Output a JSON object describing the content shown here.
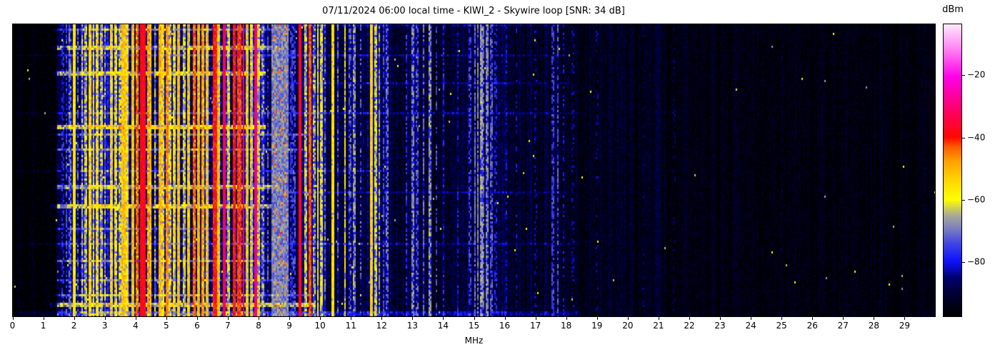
{
  "title": "07/11/2024 06:00 local time - KIWI_2 - Skywire loop [SNR: 34 dB]",
  "chart_data": {
    "type": "heatmap",
    "title": "07/11/2024 06:00 local time - KIWI_2 - Skywire loop [SNR: 34 dB]",
    "xlabel": "MHz",
    "x_range": [
      0,
      30
    ],
    "x_ticks": [
      "0",
      "1",
      "2",
      "3",
      "4",
      "5",
      "6",
      "7",
      "8",
      "9",
      "10",
      "11",
      "12",
      "13",
      "14",
      "15",
      "16",
      "17",
      "18",
      "19",
      "20",
      "21",
      "22",
      "23",
      "24",
      "25",
      "26",
      "27",
      "28",
      "29"
    ],
    "grid": false,
    "legend": "none",
    "time_rows": 136,
    "freq_bins": 645,
    "value_range_dbm": [
      -97.5,
      -3.5
    ],
    "colorbar": {
      "label": "dBm",
      "tick_values": [
        -20,
        -40,
        -60,
        -80
      ],
      "tick_labels": [
        "−20",
        "−40",
        "−60",
        "−80"
      ],
      "position": "right"
    },
    "colormap_stops": [
      [
        0.0,
        "#000000"
      ],
      [
        0.06,
        "#000026"
      ],
      [
        0.13,
        "#00006a"
      ],
      [
        0.19,
        "#0f12ff"
      ],
      [
        0.25,
        "#4146e0"
      ],
      [
        0.3,
        "#7a7ec0"
      ],
      [
        0.345,
        "#a8a899"
      ],
      [
        0.4,
        "#ffff00"
      ],
      [
        0.47,
        "#ffd200"
      ],
      [
        0.53,
        "#ffa200"
      ],
      [
        0.58,
        "#ff5a00"
      ],
      [
        0.613,
        "#ff0800"
      ],
      [
        0.7,
        "#ff0060"
      ],
      [
        0.82,
        "#ff00e8"
      ],
      [
        0.91,
        "#ff7cf2"
      ],
      [
        1.0,
        "#ffe9fd"
      ]
    ],
    "noise_floor_segments_f0_f1_level_var_activity": [
      [
        0.0,
        1.45,
        -96.5,
        3.0,
        0.35
      ],
      [
        1.45,
        2.2,
        -89.0,
        4.5,
        1.0
      ],
      [
        2.2,
        8.1,
        -86.0,
        5.0,
        1.0
      ],
      [
        8.1,
        9.3,
        -89.0,
        4.0,
        0.9
      ],
      [
        9.3,
        10.2,
        -88.5,
        4.0,
        0.8
      ],
      [
        10.2,
        12.2,
        -89.5,
        4.0,
        0.7
      ],
      [
        12.2,
        16.2,
        -91.0,
        4.0,
        0.6
      ],
      [
        16.2,
        18.2,
        -92.5,
        3.5,
        0.5
      ],
      [
        18.2,
        21.2,
        -93.5,
        3.0,
        0.35
      ],
      [
        21.2,
        30.0,
        -94.8,
        2.8,
        0.2
      ]
    ],
    "carriers_f_width_level_duty_jitter": [
      [
        1.62,
        0.02,
        -78,
        0.5,
        5
      ],
      [
        1.75,
        0.02,
        -74,
        0.6,
        5
      ],
      [
        1.85,
        0.03,
        -70,
        0.6,
        5
      ],
      [
        1.98,
        0.035,
        -57,
        1,
        4
      ],
      [
        2.12,
        0.02,
        -70,
        0.5,
        5
      ],
      [
        2.25,
        0.03,
        -63,
        0.6,
        6
      ],
      [
        2.38,
        0.03,
        -60,
        0.6,
        6
      ],
      [
        2.5,
        0.045,
        -55,
        0.9,
        5
      ],
      [
        2.62,
        0.03,
        -58,
        0.7,
        5
      ],
      [
        2.75,
        0.04,
        -56,
        0.8,
        5
      ],
      [
        2.88,
        0.03,
        -60,
        0.6,
        6
      ],
      [
        3.0,
        0.03,
        -62,
        0.5,
        6
      ],
      [
        3.2,
        0.045,
        -55,
        0.8,
        5
      ],
      [
        3.33,
        0.035,
        -58,
        0.7,
        5
      ],
      [
        3.48,
        0.03,
        -61,
        0.6,
        6
      ],
      [
        3.6,
        0.05,
        -52,
        0.9,
        5
      ],
      [
        3.72,
        0.04,
        -55,
        0.8,
        5
      ],
      [
        3.88,
        0.045,
        -52,
        0.9,
        5
      ],
      [
        4.05,
        0.05,
        -44,
        0.9,
        4
      ],
      [
        4.23,
        0.12,
        -38,
        1,
        3
      ],
      [
        4.4,
        0.05,
        -46,
        0.8,
        5
      ],
      [
        4.48,
        0.04,
        -52,
        0.8,
        5
      ],
      [
        4.62,
        0.03,
        -61,
        0.5,
        6
      ],
      [
        4.78,
        0.05,
        -50,
        0.9,
        5
      ],
      [
        4.88,
        0.035,
        -56,
        0.7,
        5
      ],
      [
        5.0,
        0.05,
        -46,
        0.95,
        4
      ],
      [
        5.12,
        0.03,
        -58,
        0.6,
        5
      ],
      [
        5.26,
        0.04,
        -56,
        0.7,
        5
      ],
      [
        5.4,
        0.05,
        -52,
        0.8,
        5
      ],
      [
        5.56,
        0.03,
        -58,
        0.6,
        5
      ],
      [
        5.7,
        0.04,
        -54,
        0.7,
        5
      ],
      [
        5.9,
        0.05,
        -44,
        0.9,
        4
      ],
      [
        6.05,
        0.05,
        -50,
        0.9,
        5
      ],
      [
        6.18,
        0.05,
        -48,
        0.9,
        5
      ],
      [
        6.3,
        0.04,
        -52,
        0.8,
        5
      ],
      [
        6.56,
        0.08,
        -40,
        1,
        3
      ],
      [
        6.7,
        0.04,
        -54,
        0.7,
        5
      ],
      [
        6.87,
        0.035,
        -33,
        1,
        3
      ],
      [
        7.0,
        0.03,
        -58,
        0.6,
        5
      ],
      [
        7.2,
        0.07,
        -40,
        1,
        3
      ],
      [
        7.35,
        0.07,
        -42,
        1,
        3
      ],
      [
        7.5,
        0.03,
        -35,
        1,
        3
      ],
      [
        7.6,
        0.04,
        -52,
        0.7,
        5
      ],
      [
        7.75,
        0.04,
        -55,
        0.6,
        5
      ],
      [
        7.88,
        0.035,
        -30,
        1,
        3
      ],
      [
        8.0,
        0.03,
        -58,
        0.6,
        5
      ],
      [
        8.12,
        0.02,
        -66,
        0.5,
        5
      ],
      [
        8.3,
        0.02,
        -72,
        0.5,
        5
      ],
      [
        8.68,
        0.5,
        -69,
        1,
        5
      ],
      [
        8.5,
        0.04,
        -45,
        0.12,
        4
      ],
      [
        8.62,
        0.04,
        -46,
        0.12,
        4
      ],
      [
        8.74,
        0.04,
        -45,
        0.1,
        4
      ],
      [
        8.86,
        0.04,
        -46,
        0.1,
        4
      ],
      [
        9.05,
        0.02,
        -76,
        0.6,
        4
      ],
      [
        9.15,
        0.02,
        -73,
        0.5,
        4
      ],
      [
        9.35,
        0.06,
        -37,
        1,
        2
      ],
      [
        9.52,
        0.03,
        -60,
        0.6,
        5
      ],
      [
        9.66,
        0.05,
        -43,
        1,
        3
      ],
      [
        9.8,
        0.02,
        -64,
        0.5,
        5
      ],
      [
        9.92,
        0.03,
        -58,
        0.8,
        4
      ],
      [
        10.02,
        0.025,
        -60,
        0.7,
        4
      ],
      [
        10.14,
        0.02,
        -68,
        0.5,
        5
      ],
      [
        10.4,
        0.03,
        -56,
        0.95,
        3
      ],
      [
        10.56,
        0.02,
        -70,
        0.5,
        5
      ],
      [
        10.8,
        0.03,
        -58,
        0.6,
        5
      ],
      [
        10.95,
        0.02,
        -72,
        0.5,
        5
      ],
      [
        11.1,
        0.02,
        -66,
        0.6,
        4
      ],
      [
        11.3,
        0.02,
        -72,
        0.4,
        5
      ],
      [
        11.65,
        0.035,
        -54,
        0.95,
        3
      ],
      [
        11.8,
        0.025,
        -62,
        0.7,
        4
      ],
      [
        11.9,
        0.02,
        -65,
        0.6,
        4
      ],
      [
        12.05,
        0.02,
        -74,
        0.6,
        4
      ],
      [
        12.16,
        0.02,
        -70,
        0.5,
        4
      ],
      [
        12.8,
        0.02,
        -76,
        0.5,
        4
      ],
      [
        13.0,
        0.025,
        -68,
        0.6,
        4
      ],
      [
        13.15,
        0.02,
        -72,
        0.5,
        4
      ],
      [
        13.35,
        0.02,
        -70,
        0.5,
        4
      ],
      [
        13.57,
        0.025,
        -66,
        0.6,
        4
      ],
      [
        13.76,
        0.02,
        -74,
        0.4,
        4
      ],
      [
        14.0,
        0.02,
        -77,
        0.4,
        4
      ],
      [
        14.47,
        0.02,
        -79,
        0.4,
        4
      ],
      [
        14.86,
        0.02,
        -75,
        0.5,
        4
      ],
      [
        15.03,
        0.03,
        -71,
        0.8,
        4
      ],
      [
        15.12,
        0.025,
        -69,
        0.8,
        4
      ],
      [
        15.22,
        0.03,
        -66,
        0.8,
        4
      ],
      [
        15.31,
        0.025,
        -70,
        0.7,
        4
      ],
      [
        15.43,
        0.025,
        -68,
        0.7,
        4
      ],
      [
        15.55,
        0.03,
        -72,
        0.6,
        4
      ],
      [
        15.7,
        0.02,
        -78,
        0.4,
        4
      ],
      [
        16.05,
        0.02,
        -80,
        0.4,
        4
      ],
      [
        16.37,
        0.02,
        -82,
        0.3,
        4
      ],
      [
        17.0,
        0.02,
        -83,
        0.3,
        4
      ],
      [
        17.55,
        0.025,
        -75,
        0.6,
        4
      ],
      [
        17.72,
        0.025,
        -73,
        0.6,
        4
      ],
      [
        17.9,
        0.02,
        -80,
        0.3,
        4
      ],
      [
        18.2,
        0.02,
        -83,
        0.3,
        4
      ],
      [
        19.0,
        0.02,
        -85,
        0.25,
        4
      ],
      [
        20.5,
        0.02,
        -86,
        0.2,
        4
      ],
      [
        21.5,
        0.02,
        -87,
        0.2,
        4
      ],
      [
        25.0,
        0.02,
        -89,
        0.15,
        4
      ]
    ],
    "bursts_rowfrac_nrows_f0_f1_boost": [
      [
        0.0,
        1,
        8.5,
        18.0,
        8
      ],
      [
        0.02,
        1,
        1.3,
        9.0,
        14
      ],
      [
        0.075,
        2,
        1.3,
        8.6,
        20
      ],
      [
        0.105,
        1,
        0.2,
        18.0,
        10
      ],
      [
        0.165,
        2,
        1.3,
        8.2,
        22
      ],
      [
        0.2,
        1,
        8.5,
        18.0,
        9
      ],
      [
        0.3,
        1,
        0.2,
        18.5,
        11
      ],
      [
        0.345,
        2,
        1.2,
        8.2,
        26
      ],
      [
        0.375,
        1,
        1.2,
        9.6,
        16
      ],
      [
        0.43,
        1,
        1.3,
        9.5,
        16
      ],
      [
        0.5,
        1,
        0.2,
        12.0,
        10
      ],
      [
        0.55,
        2,
        1.3,
        8.6,
        20
      ],
      [
        0.575,
        1,
        8.5,
        18.0,
        9
      ],
      [
        0.62,
        2,
        1.2,
        8.4,
        24
      ],
      [
        0.7,
        1,
        1.3,
        8.2,
        12
      ],
      [
        0.75,
        1,
        0.2,
        18.5,
        10
      ],
      [
        0.805,
        1,
        1.3,
        8.6,
        16
      ],
      [
        0.875,
        1,
        1.3,
        9.0,
        12
      ],
      [
        0.92,
        1,
        1.3,
        9.6,
        18
      ],
      [
        0.955,
        2,
        1.2,
        9.8,
        24
      ],
      [
        0.985,
        2,
        0.2,
        18.5,
        14
      ]
    ]
  }
}
